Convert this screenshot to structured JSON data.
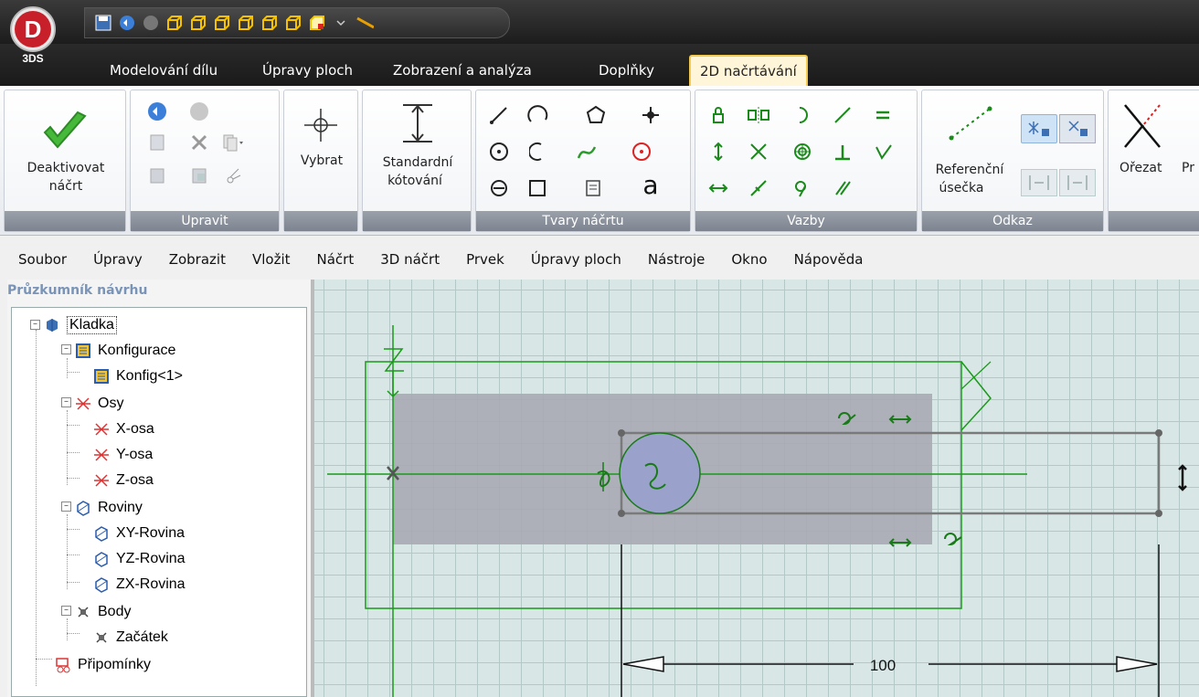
{
  "tabs": [
    {
      "label": "Modelování dílu"
    },
    {
      "label": "Úpravy ploch"
    },
    {
      "label": "Zobrazení a analýza"
    },
    {
      "label": "Doplňky"
    },
    {
      "label": "2D načrtávání",
      "active": true
    }
  ],
  "app_logo": {
    "letter": "D",
    "sub": "3DS"
  },
  "ribbon": {
    "deactivate": {
      "line1": "Deaktivovat",
      "line2": "náčrt"
    },
    "group_upravit": "Upravit",
    "select": "Vybrat",
    "dimension": {
      "line1": "Standardní",
      "line2": "kótování"
    },
    "group_tvary": "Tvary náčrtu",
    "text_tool": "a",
    "group_vazby": "Vazby",
    "reference": {
      "line1": "Referenční",
      "line2": "úsečka"
    },
    "group_odkaz": "Odkaz",
    "trim": "Ořezat",
    "trim_next": "Pr"
  },
  "menu": [
    "Soubor",
    "Úpravy",
    "Zobrazit",
    "Vložit",
    "Náčrt",
    "3D náčrt",
    "Prvek",
    "Úpravy ploch",
    "Nástroje",
    "Okno",
    "Nápověda"
  ],
  "explorer": {
    "title": "Průzkumník návrhu",
    "tree": [
      {
        "label": "Kladka",
        "icon": "part-icon"
      },
      {
        "label": "Konfigurace",
        "icon": "configuration-icon"
      },
      {
        "label": "Konfig<1>",
        "icon": "configuration-icon"
      },
      {
        "label": "Osy",
        "icon": "axes-icon"
      },
      {
        "label": "X-osa",
        "icon": "axis-icon"
      },
      {
        "label": "Y-osa",
        "icon": "axis-icon"
      },
      {
        "label": "Z-osa",
        "icon": "axis-icon"
      },
      {
        "label": "Roviny",
        "icon": "planes-icon"
      },
      {
        "label": "XY-Rovina",
        "icon": "plane-icon"
      },
      {
        "label": "YZ-Rovina",
        "icon": "plane-icon"
      },
      {
        "label": "ZX-Rovina",
        "icon": "plane-icon"
      },
      {
        "label": "Body",
        "icon": "points-icon"
      },
      {
        "label": "Začátek",
        "icon": "point-icon"
      },
      {
        "label": "Připomínky",
        "icon": "annotations-icon"
      }
    ]
  },
  "sketch": {
    "dimension_value": "100"
  },
  "colors": {
    "sketch_green": "#1a9a1a",
    "selection_gray": "#7a7a7a",
    "shaded_region": "#a8aab4",
    "circle_fill": "#9aa2cc"
  }
}
